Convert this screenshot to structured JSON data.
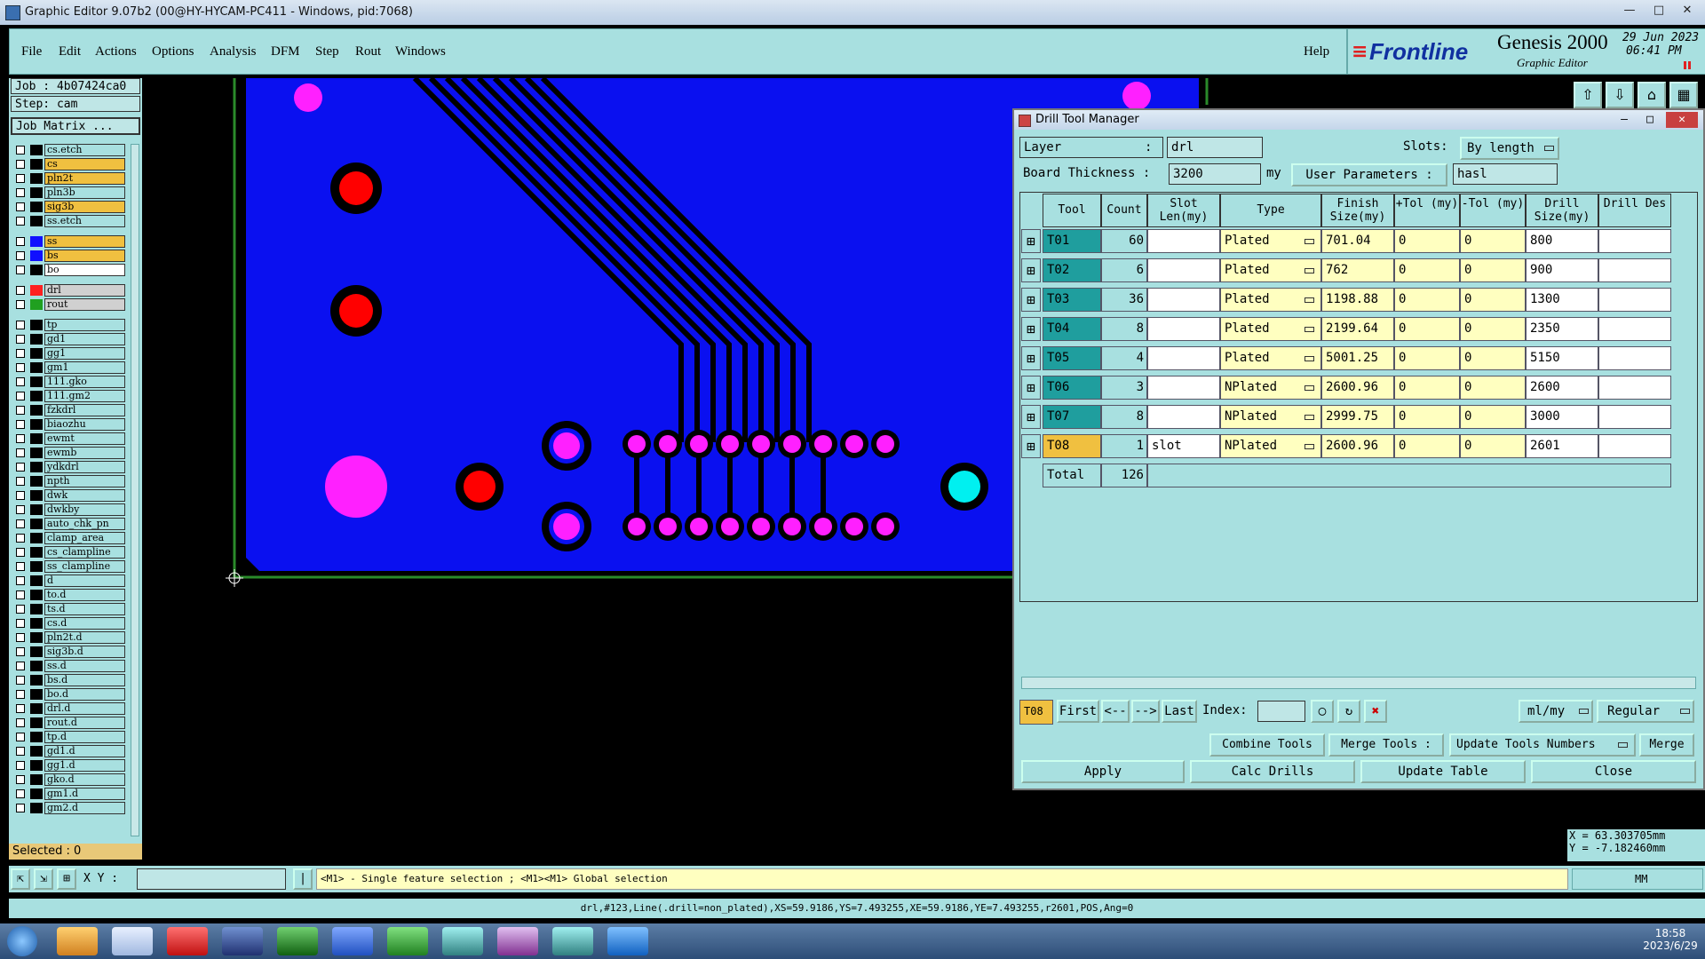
{
  "window": {
    "title": "Graphic Editor 9.07b2 (00@HY-HYCAM-PC411 - Windows, pid:7068)"
  },
  "menu": [
    "File",
    "Edit",
    "Actions",
    "Options",
    "Analysis",
    "DFM",
    "Step",
    "Rout",
    "Windows"
  ],
  "help": "Help",
  "brand": {
    "logo": "Frontline",
    "product": "Genesis 2000",
    "subtitle": "Graphic Editor",
    "date": "29 Jun 2023",
    "time": "06:41 PM"
  },
  "job": {
    "job": "Job : 4b07424ca0",
    "step": "Step: cam",
    "matrix": "Job Matrix ..."
  },
  "layers": [
    {
      "name": "cs.etch",
      "color": "#000000",
      "hl": ""
    },
    {
      "name": "cs",
      "color": "#000000",
      "hl": "#f0c040"
    },
    {
      "name": "pln2t",
      "color": "#000000",
      "hl": "#f0c040"
    },
    {
      "name": "pln3b",
      "color": "#000000",
      "hl": ""
    },
    {
      "name": "sig3b",
      "color": "#000000",
      "hl": "#f0c040"
    },
    {
      "name": "ss.etch",
      "color": "#000000",
      "hl": ""
    },
    {
      "name": "ss",
      "color": "#1010ff",
      "hl": "#f0c040"
    },
    {
      "name": "bs",
      "color": "#1010ff",
      "hl": "#f0c040"
    },
    {
      "name": "bo",
      "color": "#000000",
      "hl": "#ffffff"
    },
    {
      "name": "drl",
      "color": "#ff2020",
      "hl": "#d0d0d0"
    },
    {
      "name": "rout",
      "color": "#20a020",
      "hl": "#d0d0d0"
    },
    {
      "name": "tp",
      "color": "#000000",
      "hl": ""
    },
    {
      "name": "gd1",
      "color": "#000000",
      "hl": ""
    },
    {
      "name": "gg1",
      "color": "#000000",
      "hl": ""
    },
    {
      "name": "gm1",
      "color": "#000000",
      "hl": ""
    },
    {
      "name": "111.gko",
      "color": "#000000",
      "hl": ""
    },
    {
      "name": "111.gm2",
      "color": "#000000",
      "hl": ""
    },
    {
      "name": "fzkdrl",
      "color": "#000000",
      "hl": ""
    },
    {
      "name": "biaozhu",
      "color": "#000000",
      "hl": ""
    },
    {
      "name": "ewmt",
      "color": "#000000",
      "hl": ""
    },
    {
      "name": "ewmb",
      "color": "#000000",
      "hl": ""
    },
    {
      "name": "ydkdrl",
      "color": "#000000",
      "hl": ""
    },
    {
      "name": "npth",
      "color": "#000000",
      "hl": ""
    },
    {
      "name": "dwk",
      "color": "#000000",
      "hl": ""
    },
    {
      "name": "dwkby",
      "color": "#000000",
      "hl": ""
    },
    {
      "name": "auto_chk_pn",
      "color": "#000000",
      "hl": ""
    },
    {
      "name": "clamp_area",
      "color": "#000000",
      "hl": ""
    },
    {
      "name": "cs_clampline",
      "color": "#000000",
      "hl": ""
    },
    {
      "name": "ss_clampline",
      "color": "#000000",
      "hl": ""
    },
    {
      "name": "d",
      "color": "#000000",
      "hl": ""
    },
    {
      "name": "to.d",
      "color": "#000000",
      "hl": ""
    },
    {
      "name": "ts.d",
      "color": "#000000",
      "hl": ""
    },
    {
      "name": "cs.d",
      "color": "#000000",
      "hl": ""
    },
    {
      "name": "pln2t.d",
      "color": "#000000",
      "hl": ""
    },
    {
      "name": "sig3b.d",
      "color": "#000000",
      "hl": ""
    },
    {
      "name": "ss.d",
      "color": "#000000",
      "hl": ""
    },
    {
      "name": "bs.d",
      "color": "#000000",
      "hl": ""
    },
    {
      "name": "bo.d",
      "color": "#000000",
      "hl": ""
    },
    {
      "name": "drl.d",
      "color": "#000000",
      "hl": ""
    },
    {
      "name": "rout.d",
      "color": "#000000",
      "hl": ""
    },
    {
      "name": "tp.d",
      "color": "#000000",
      "hl": ""
    },
    {
      "name": "gd1.d",
      "color": "#000000",
      "hl": ""
    },
    {
      "name": "gg1.d",
      "color": "#000000",
      "hl": ""
    },
    {
      "name": "gko.d",
      "color": "#000000",
      "hl": ""
    },
    {
      "name": "gm1.d",
      "color": "#000000",
      "hl": ""
    },
    {
      "name": "gm2.d",
      "color": "#000000",
      "hl": ""
    }
  ],
  "selected": "Selected : 0",
  "coords": {
    "x": "X = 63.303705mm",
    "y": "Y = -7.182460mm"
  },
  "cmd": {
    "xy_label": "X Y :",
    "xy_value": "",
    "hint": "<M1> - Single feature selection ; <M1><M1> Global selection",
    "units": "MM"
  },
  "status": "drl,#123,Line(.drill=non_plated),XS=59.9186,YS=7.493255,XE=59.9186,YE=7.493255,r2601,POS,Ang=0",
  "dtm": {
    "title": "Drill Tool Manager",
    "layer_label": "Layer",
    "layer_colon": ":",
    "layer_value": "drl",
    "slots_label": "Slots:",
    "slots_value": "By length",
    "thickness_label": "Board Thickness :",
    "thickness_value": "3200",
    "thickness_unit": "my",
    "userparams_label": "User Parameters :",
    "userparams_value": "hasl",
    "headers": [
      "Tool",
      "Count",
      "Slot Len(my)",
      "Type",
      "Finish Size(my)",
      "+Tol (my)",
      "-Tol (my)",
      "Drill Size(my)",
      "Drill Des"
    ],
    "rows": [
      {
        "tool": "T01",
        "count": "60",
        "slot": "",
        "type": "Plated",
        "finish": "701.04",
        "ptol": "0",
        "mtol": "0",
        "drill": "800",
        "des": ""
      },
      {
        "tool": "T02",
        "count": "6",
        "slot": "",
        "type": "Plated",
        "finish": "762",
        "ptol": "0",
        "mtol": "0",
        "drill": "900",
        "des": ""
      },
      {
        "tool": "T03",
        "count": "36",
        "slot": "",
        "type": "Plated",
        "finish": "1198.88",
        "ptol": "0",
        "mtol": "0",
        "drill": "1300",
        "des": ""
      },
      {
        "tool": "T04",
        "count": "8",
        "slot": "",
        "type": "Plated",
        "finish": "2199.64",
        "ptol": "0",
        "mtol": "0",
        "drill": "2350",
        "des": ""
      },
      {
        "tool": "T05",
        "count": "4",
        "slot": "",
        "type": "Plated",
        "finish": "5001.25",
        "ptol": "0",
        "mtol": "0",
        "drill": "5150",
        "des": ""
      },
      {
        "tool": "T06",
        "count": "3",
        "slot": "",
        "type": "NPlated",
        "finish": "2600.96",
        "ptol": "0",
        "mtol": "0",
        "drill": "2600",
        "des": ""
      },
      {
        "tool": "T07",
        "count": "8",
        "slot": "",
        "type": "NPlated",
        "finish": "2999.75",
        "ptol": "0",
        "mtol": "0",
        "drill": "3000",
        "des": ""
      },
      {
        "tool": "T08",
        "count": "1",
        "slot": "slot",
        "type": "NPlated",
        "finish": "2600.96",
        "ptol": "0",
        "mtol": "0",
        "drill": "2601",
        "des": ""
      }
    ],
    "total_label": "Total",
    "total_count": "126",
    "current_tool": "T08",
    "first": "First",
    "prev": "<--",
    "next": "-->",
    "last": "Last",
    "index_label": "Index:",
    "units": "ml/my",
    "mode": "Regular",
    "combine": "Combine Tools",
    "merge_tools": "Merge Tools :",
    "update_numbers": "Update Tools Numbers",
    "merge": "Merge",
    "apply": "Apply",
    "calc": "Calc Drills",
    "update_table": "Update Table",
    "close": "Close"
  },
  "clock": {
    "time": "18:58",
    "date": "2023/6/29"
  }
}
